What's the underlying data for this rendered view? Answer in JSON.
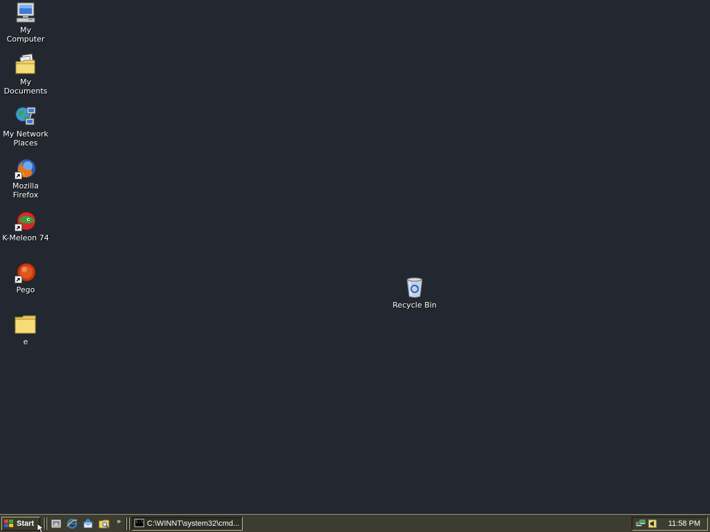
{
  "desktop": {
    "background_color": "#232830",
    "icons": [
      {
        "label": "My Computer",
        "icon": "computer-icon"
      },
      {
        "label": "My Documents",
        "icon": "documents-folder-icon"
      },
      {
        "label": "My Network Places",
        "icon": "network-places-icon"
      },
      {
        "label": "Mozilla Firefox",
        "icon": "firefox-icon",
        "shortcut": true
      },
      {
        "label": "K-Meleon 74",
        "icon": "k-meleon-icon",
        "shortcut": true
      },
      {
        "label": "Pego",
        "icon": "pego-icon",
        "shortcut": true
      },
      {
        "label": "e",
        "icon": "folder-icon"
      }
    ],
    "recycle_bin": {
      "label": "Recycle Bin",
      "icon": "recycle-bin-icon"
    }
  },
  "taskbar": {
    "start_label": "Start",
    "quick_launch": [
      "show-desktop-icon",
      "internet-explorer-icon",
      "outlook-express-icon",
      "windows-explorer-icon"
    ],
    "chevron": "»",
    "tasks": [
      {
        "label": "C:\\WINNT\\system32\\cmd...",
        "icon": "command-prompt-icon"
      }
    ],
    "tray": {
      "icons": [
        "network-tray-icon",
        "volume-tray-icon"
      ],
      "clock": "11:58 PM"
    }
  }
}
